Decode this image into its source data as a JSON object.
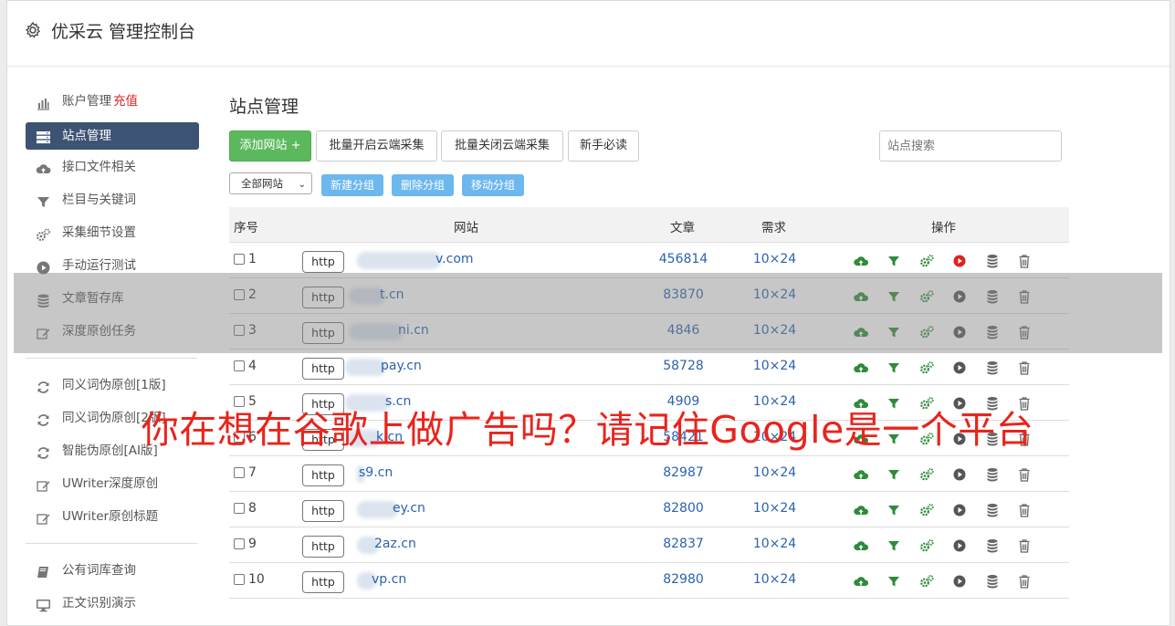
{
  "app": {
    "title": "优采云 管理控制台"
  },
  "sidebar": {
    "group1": [
      {
        "label": "账户管理",
        "extra": "充值",
        "icon": "bar-chart-icon"
      },
      {
        "label": "站点管理",
        "icon": "server-list-icon",
        "active": true
      },
      {
        "label": "接口文件相关",
        "icon": "cloud-upload-icon"
      },
      {
        "label": "栏目与关键词",
        "icon": "filter-icon"
      },
      {
        "label": "采集细节设置",
        "icon": "cogs-icon"
      },
      {
        "label": "手动运行测试",
        "icon": "play-circle-icon"
      },
      {
        "label": "文章暂存库",
        "icon": "database-icon"
      },
      {
        "label": "深度原创任务",
        "icon": "edit-icon"
      }
    ],
    "group2": [
      {
        "label": "同义词伪原创[1版]",
        "icon": "refresh-icon"
      },
      {
        "label": "同义词伪原创[2版]",
        "icon": "refresh-icon"
      },
      {
        "label": "智能伪原创[AI版]",
        "icon": "refresh-icon"
      },
      {
        "label": "UWriter深度原创",
        "icon": "edit-icon"
      },
      {
        "label": "UWriter原创标题",
        "icon": "edit-icon"
      }
    ],
    "group3": [
      {
        "label": "公有词库查询",
        "icon": "book-icon"
      },
      {
        "label": "正文识别演示",
        "icon": "monitor-icon"
      }
    ]
  },
  "main": {
    "title": "站点管理",
    "toolbar": {
      "add_site": "添加网站 +",
      "batch_open": "批量开启云端采集",
      "batch_close": "批量关闭云端采集",
      "newbie": "新手必读",
      "search_placeholder": "站点搜索"
    },
    "group_bar": {
      "select_value": "全部网站",
      "new_group": "新建分组",
      "delete_group": "删除分组",
      "move_group": "移动分组"
    },
    "table": {
      "headers": {
        "no": "序号",
        "site": "网站",
        "articles": "文章",
        "demand": "需求",
        "ops": "操作"
      },
      "rows": [
        {
          "no": "1",
          "proto": "http",
          "site": "v.com",
          "articles": "456814",
          "demand": "10×24",
          "play_color": "#e02020"
        },
        {
          "no": "2",
          "proto": "http",
          "site": "t.cn",
          "articles": "83870",
          "demand": "10×24",
          "play_color": "#555555"
        },
        {
          "no": "3",
          "proto": "http",
          "site": "ni.cn",
          "articles": "4846",
          "demand": "10×24",
          "play_color": "#555555"
        },
        {
          "no": "4",
          "proto": "http",
          "site": "pay.cn",
          "articles": "58728",
          "demand": "10×24",
          "play_color": "#555555"
        },
        {
          "no": "5",
          "proto": "http",
          "site": "s.cn",
          "articles": "4909",
          "demand": "10×24",
          "play_color": "#555555"
        },
        {
          "no": "6",
          "proto": "http",
          "site": "k.cn",
          "articles": "58421",
          "demand": "10×24",
          "play_color": "#555555"
        },
        {
          "no": "7",
          "proto": "http",
          "site": "s9.cn",
          "articles": "82987",
          "demand": "10×24",
          "play_color": "#555555"
        },
        {
          "no": "8",
          "proto": "http",
          "site": "ey.cn",
          "articles": "82800",
          "demand": "10×24",
          "play_color": "#555555"
        },
        {
          "no": "9",
          "proto": "http",
          "site": "2az.cn",
          "articles": "82837",
          "demand": "10×24",
          "play_color": "#555555"
        },
        {
          "no": "10",
          "proto": "http",
          "site": "vp.cn",
          "articles": "82980",
          "demand": "10×24",
          "play_color": "#555555"
        }
      ]
    }
  },
  "watermark": "你在想在谷歌上做广告吗？请记住Google是一个平台",
  "colors": {
    "active_nav": "#3d5373",
    "green": "#5cb85c",
    "link": "#2a62b0",
    "watermark": "#e8241c"
  }
}
